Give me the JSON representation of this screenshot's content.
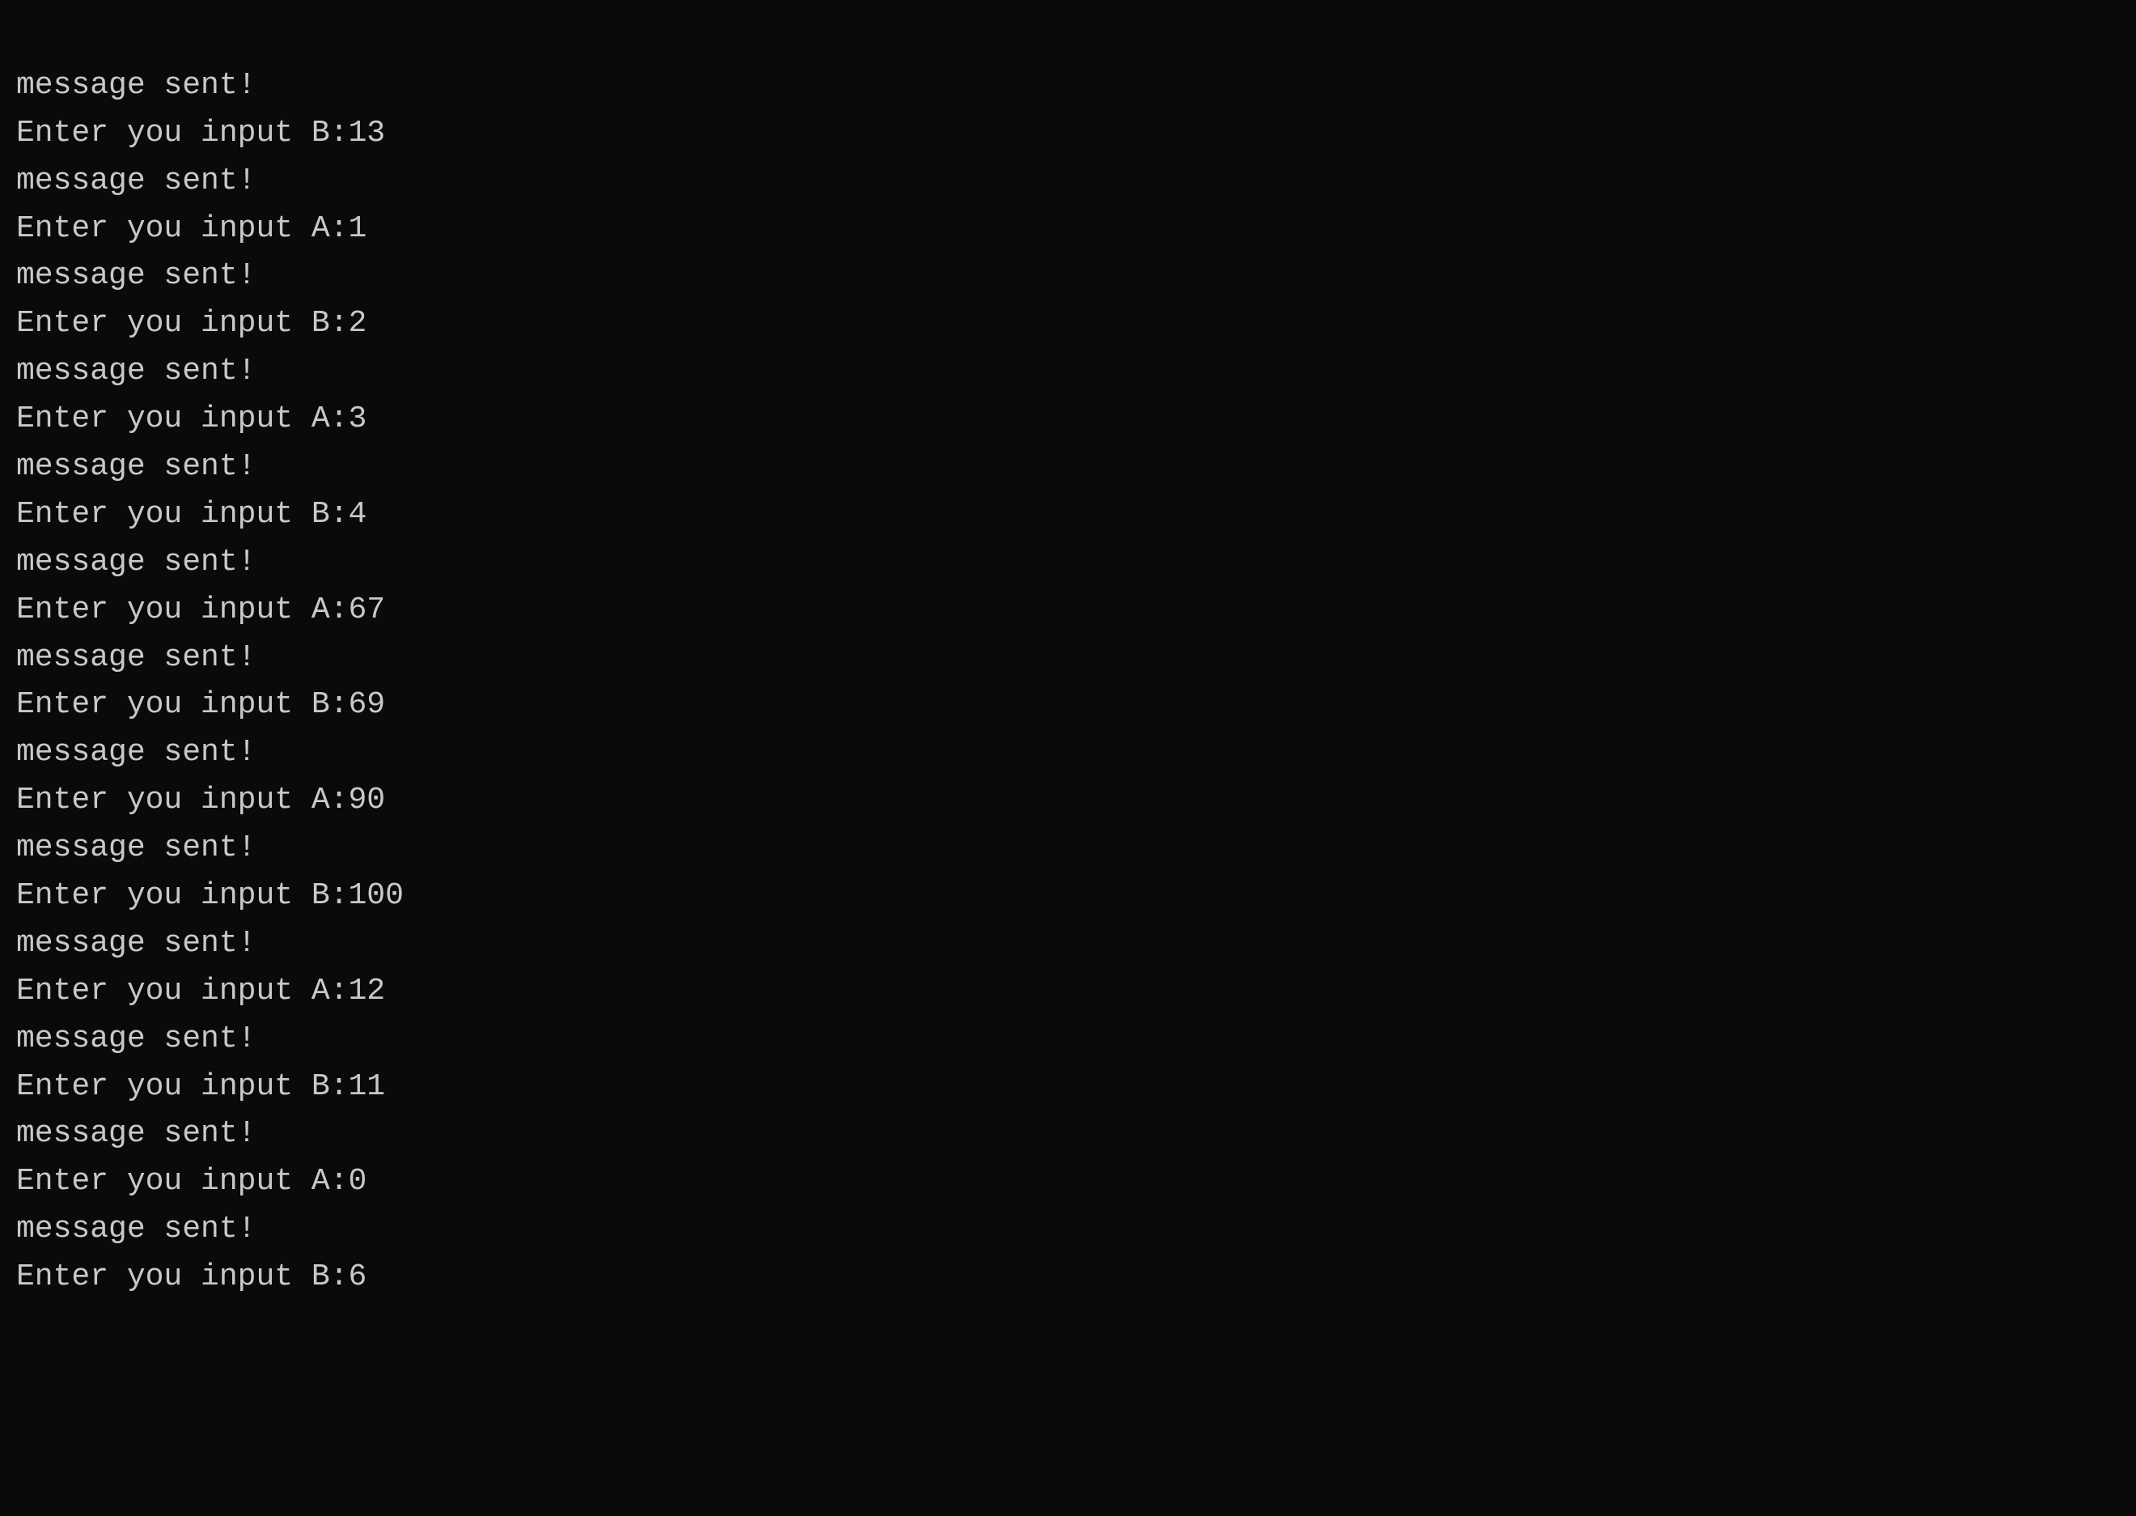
{
  "terminal": {
    "lines": [
      {
        "id": 1,
        "text": "message sent!"
      },
      {
        "id": 2,
        "text": "Enter you input B:13"
      },
      {
        "id": 3,
        "text": "message sent!"
      },
      {
        "id": 4,
        "text": "Enter you input A:1"
      },
      {
        "id": 5,
        "text": "message sent!"
      },
      {
        "id": 6,
        "text": "Enter you input B:2"
      },
      {
        "id": 7,
        "text": "message sent!"
      },
      {
        "id": 8,
        "text": "Enter you input A:3"
      },
      {
        "id": 9,
        "text": "message sent!"
      },
      {
        "id": 10,
        "text": "Enter you input B:4"
      },
      {
        "id": 11,
        "text": "message sent!"
      },
      {
        "id": 12,
        "text": "Enter you input A:67"
      },
      {
        "id": 13,
        "text": "message sent!"
      },
      {
        "id": 14,
        "text": "Enter you input B:69"
      },
      {
        "id": 15,
        "text": "message sent!"
      },
      {
        "id": 16,
        "text": "Enter you input A:90"
      },
      {
        "id": 17,
        "text": "message sent!"
      },
      {
        "id": 18,
        "text": "Enter you input B:100"
      },
      {
        "id": 19,
        "text": "message sent!"
      },
      {
        "id": 20,
        "text": "Enter you input A:12"
      },
      {
        "id": 21,
        "text": "message sent!"
      },
      {
        "id": 22,
        "text": "Enter you input B:11"
      },
      {
        "id": 23,
        "text": "message sent!"
      },
      {
        "id": 24,
        "text": "Enter you input A:0"
      },
      {
        "id": 25,
        "text": "message sent!"
      },
      {
        "id": 26,
        "text": "Enter you input B:6"
      }
    ]
  }
}
